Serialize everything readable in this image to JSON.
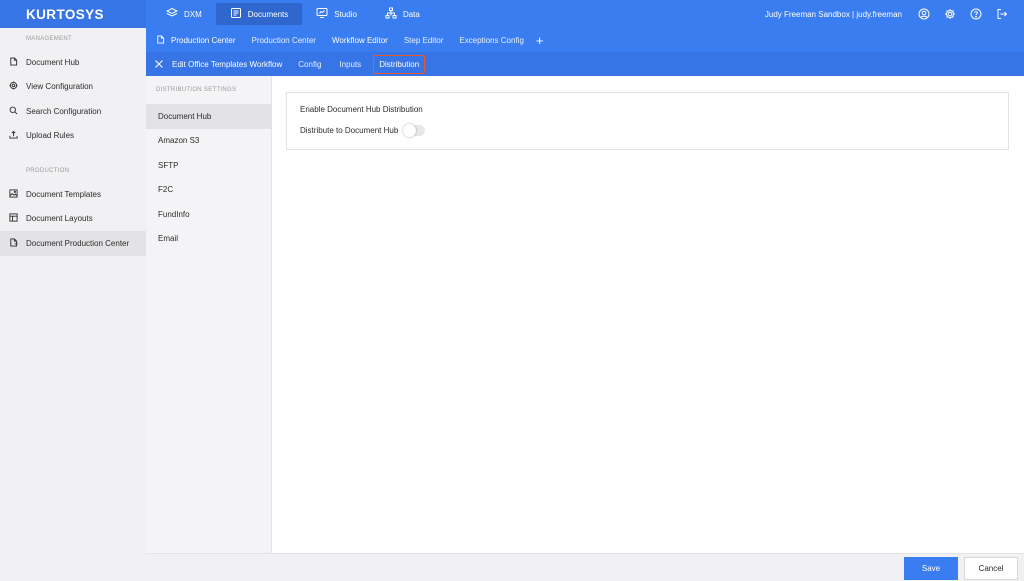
{
  "brand": "KURTOSYS",
  "topnav": {
    "items": [
      {
        "label": "DXM",
        "icon": "layers-icon"
      },
      {
        "label": "Documents",
        "icon": "documents-icon"
      },
      {
        "label": "Studio",
        "icon": "studio-icon"
      },
      {
        "label": "Data",
        "icon": "hierarchy-icon"
      }
    ],
    "active": "Documents",
    "user": "Judy Freeman Sandbox | judy.freeman"
  },
  "sidebar": {
    "sections": [
      {
        "heading": "MANAGEMENT",
        "items": [
          {
            "label": "Document Hub",
            "icon": "file-icon"
          },
          {
            "label": "View Configuration",
            "icon": "gear-icon"
          },
          {
            "label": "Search Configuration",
            "icon": "search-icon"
          },
          {
            "label": "Upload Rules",
            "icon": "upload-icon"
          }
        ]
      },
      {
        "heading": "PRODUCTION",
        "items": [
          {
            "label": "Document Templates",
            "icon": "image-icon"
          },
          {
            "label": "Document Layouts",
            "icon": "layout-icon"
          },
          {
            "label": "Document Production Center",
            "icon": "file-export-icon"
          }
        ]
      }
    ],
    "active": "Document Production Center"
  },
  "subnav": {
    "items": [
      "Production Center",
      "Production Center",
      "Workflow Editor",
      "Step Editor",
      "Exceptions Config"
    ],
    "add_label": "+"
  },
  "tabbar": {
    "title": "Edit Office Templates Workflow",
    "tabs": [
      "Config",
      "Inputs",
      "Distribution"
    ],
    "active": "Distribution"
  },
  "distribution": {
    "heading": "DISTRIBUTION SETTINGS",
    "items": [
      "Document Hub",
      "Amazon S3",
      "SFTP",
      "F2C",
      "FundInfo",
      "Email"
    ],
    "active": "Document Hub"
  },
  "card": {
    "title": "Enable Document Hub Distribution",
    "toggle_label": "Distribute to Document Hub",
    "toggle_on": false
  },
  "footer": {
    "save_label": "Save",
    "cancel_label": "Cancel"
  },
  "colors": {
    "primary": "#3a7df0",
    "highlight_border": "#e8572d",
    "sidebar_bg": "#f1f1f3"
  }
}
